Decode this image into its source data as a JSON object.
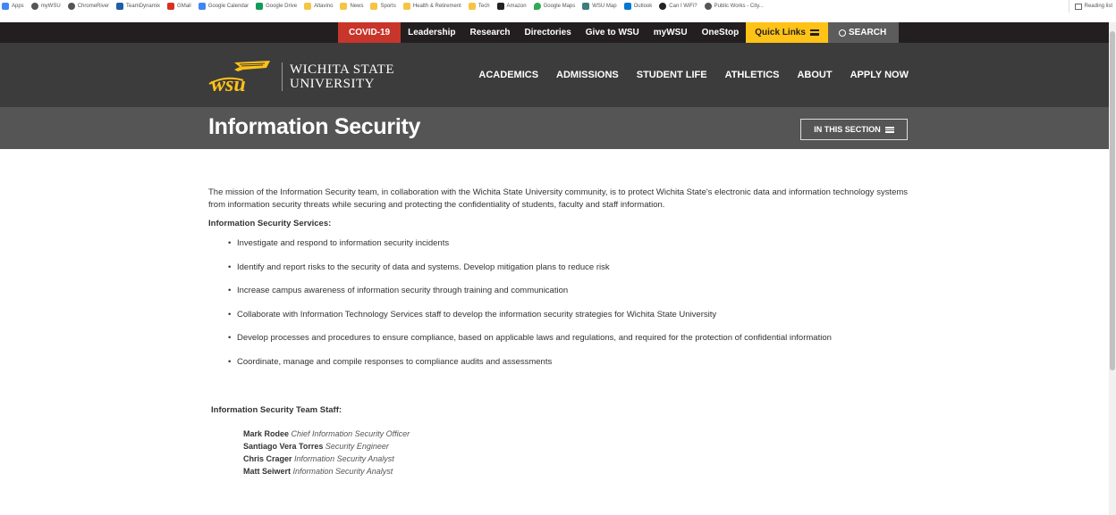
{
  "bookmarks": [
    {
      "label": "Apps",
      "color": "#4285f4"
    },
    {
      "label": "myWSU",
      "color": "#555555"
    },
    {
      "label": "ChromeRiver",
      "color": "#555555"
    },
    {
      "label": "TeamDynamix",
      "color": "#1f5fa8"
    },
    {
      "label": "GMail",
      "color": "#d93025"
    },
    {
      "label": "Google Calendar",
      "color": "#4285f4"
    },
    {
      "label": "Google Drive",
      "color": "#0f9d58"
    },
    {
      "label": "Altavino",
      "color": "#f4c542"
    },
    {
      "label": "News",
      "color": "#f4c542"
    },
    {
      "label": "Sports",
      "color": "#f4c542"
    },
    {
      "label": "Health & Retirement",
      "color": "#f4c542"
    },
    {
      "label": "Tech",
      "color": "#f4c542"
    },
    {
      "label": "Amazon",
      "color": "#222222"
    },
    {
      "label": "Google Maps",
      "color": "#34a853"
    },
    {
      "label": "WSU Map",
      "color": "#3c7d7d"
    },
    {
      "label": "Outlook",
      "color": "#0078d4"
    },
    {
      "label": "Can I WiFi?",
      "color": "#222222"
    },
    {
      "label": "Public Works - City...",
      "color": "#555555"
    }
  ],
  "reading_list": "Reading list",
  "utility": {
    "covid": "COVID-19",
    "leadership": "Leadership",
    "research": "Research",
    "directories": "Directories",
    "give": "Give to WSU",
    "mywsu": "myWSU",
    "onestop": "OneStop",
    "quick_links": "Quick Links",
    "search": "SEARCH"
  },
  "logo": {
    "line1": "WICHITA STATE",
    "line2": "UNIVERSITY"
  },
  "nav": {
    "academics": "ACADEMICS",
    "admissions": "ADMISSIONS",
    "student_life": "STUDENT LIFE",
    "athletics": "ATHLETICS",
    "about": "ABOUT",
    "apply": "APPLY NOW"
  },
  "page": {
    "title": "Information Security",
    "in_this_section": "IN THIS SECTION"
  },
  "content": {
    "mission": "The mission of the Information Security team, in collaboration with the Wichita State University community, is to protect Wichita State's electronic data and information technology systems from information security threats while securing and protecting the confidentiality of students, faculty and staff information.",
    "services_heading": "Information Security Services:",
    "services": [
      "Investigate and respond to information security incidents",
      "Identify and report risks to the security of data and systems. Develop mitigation plans to reduce risk",
      "Increase campus awareness of information security through training and communication",
      "Collaborate with Information Technology Services staff to develop the information security strategies for Wichita State University",
      "Develop processes and procedures to ensure compliance, based on applicable laws and regulations, and required for the protection of confidential information",
      "Coordinate, manage and compile responses to compliance audits and assessments"
    ],
    "staff_heading": "Information Security Team Staff:",
    "staff": [
      {
        "name": "Mark Rodee",
        "role": "Chief Information Security Officer"
      },
      {
        "name": "Santiago Vera Torres",
        "role": "Security Engineer"
      },
      {
        "name": "Chris Crager",
        "role": "Information Security Analyst"
      },
      {
        "name": "Matt Seiwert",
        "role": "Information Security Analyst"
      }
    ]
  },
  "colors": {
    "covid_red": "#c8352b",
    "quick_links_gold": "#ffc217",
    "nav_dark": "#3c3c3c",
    "banner_gray": "#555555",
    "logo_gold": "#ffc217"
  }
}
